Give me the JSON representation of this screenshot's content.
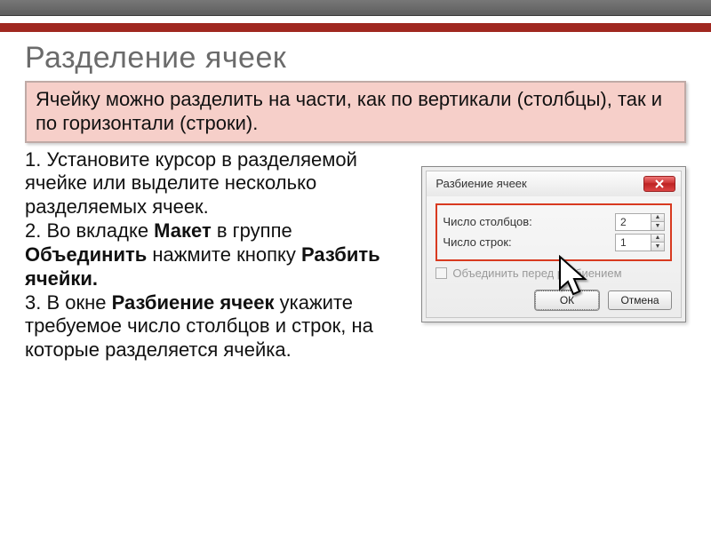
{
  "slide": {
    "title": "Разделение ячеек",
    "intro": "Ячейку можно разделить на части, как по вертикали (столбцы), так и по горизонтали (строки).",
    "steps_html": {
      "s1": "1. Установите курсор в разделяемой ячейке или выделите несколько разделяемых ячеек.",
      "s2a": "2. Во вкладке ",
      "s2b": "Макет",
      "s2c": " в группе ",
      "s2d": "Объединить",
      "s2e": " нажмите кнопку ",
      "s2f": "Разбить ячейки.",
      "s3a": "3. В окне ",
      "s3b": "Разбиение ячеек",
      "s3c": "  укажите требуемое число столбцов и строк, на которые разделяется ячейка."
    }
  },
  "dialog": {
    "title": "Разбиение ячеек",
    "cols_label": "Число столбцов:",
    "cols_value": "2",
    "rows_label": "Число строк:",
    "rows_value": "1",
    "merge_label": "Объединить перед разбиением",
    "ok": "ОК",
    "cancel": "Отмена"
  }
}
